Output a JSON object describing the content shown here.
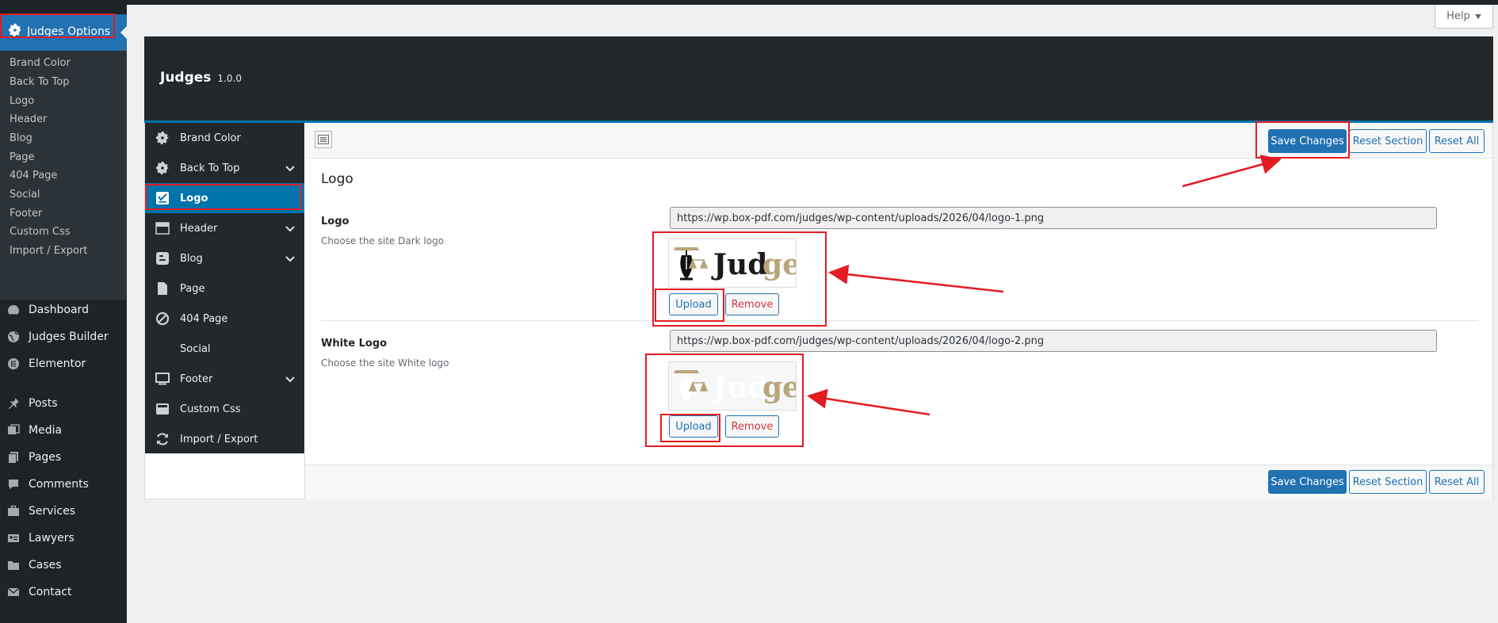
{
  "wp_menu": {
    "active": "Judges Options",
    "submenu": [
      "Brand Color",
      "Back To Top",
      "Logo",
      "Header",
      "Blog",
      "Page",
      "404 Page",
      "Social",
      "Footer",
      "Custom Css",
      "Import / Export"
    ],
    "items": [
      "Dashboard",
      "Judges Builder",
      "Elementor",
      "Posts",
      "Media",
      "Pages",
      "Comments",
      "Services",
      "Lawyers",
      "Cases",
      "Contact"
    ]
  },
  "help": {
    "label": "Help"
  },
  "panel": {
    "title": "Judges",
    "version": "1.0.0",
    "sidebar": [
      "Brand Color",
      "Back To Top",
      "Logo",
      "Header",
      "Blog",
      "Page",
      "404 Page",
      "Social",
      "Footer",
      "Custom Css",
      "Import / Export"
    ],
    "active_index": 2
  },
  "toolbar": {
    "save": "Save Changes",
    "reset_section": "Reset Section",
    "reset_all": "Reset All"
  },
  "section": {
    "title": "Logo"
  },
  "fields": [
    {
      "title": "Logo",
      "desc": "Choose the site Dark logo",
      "url": "https://wp.box-pdf.com/judges/wp-content/uploads/2026/04/logo-1.png",
      "upload": "Upload",
      "remove": "Remove",
      "preview_text_a": "Jud",
      "preview_text_b": "ge"
    },
    {
      "title": "White Logo",
      "desc": "Choose the site White logo",
      "url": "https://wp.box-pdf.com/judges/wp-content/uploads/2026/04/logo-2.png",
      "upload": "Upload",
      "remove": "Remove",
      "preview_text_a": "Jud",
      "preview_text_b": "ge"
    }
  ],
  "colors": {
    "accent": "#2271b1",
    "sidebar": "#1d2327",
    "annotation": "#e31b23",
    "logo_gold": "#b9a47a"
  }
}
